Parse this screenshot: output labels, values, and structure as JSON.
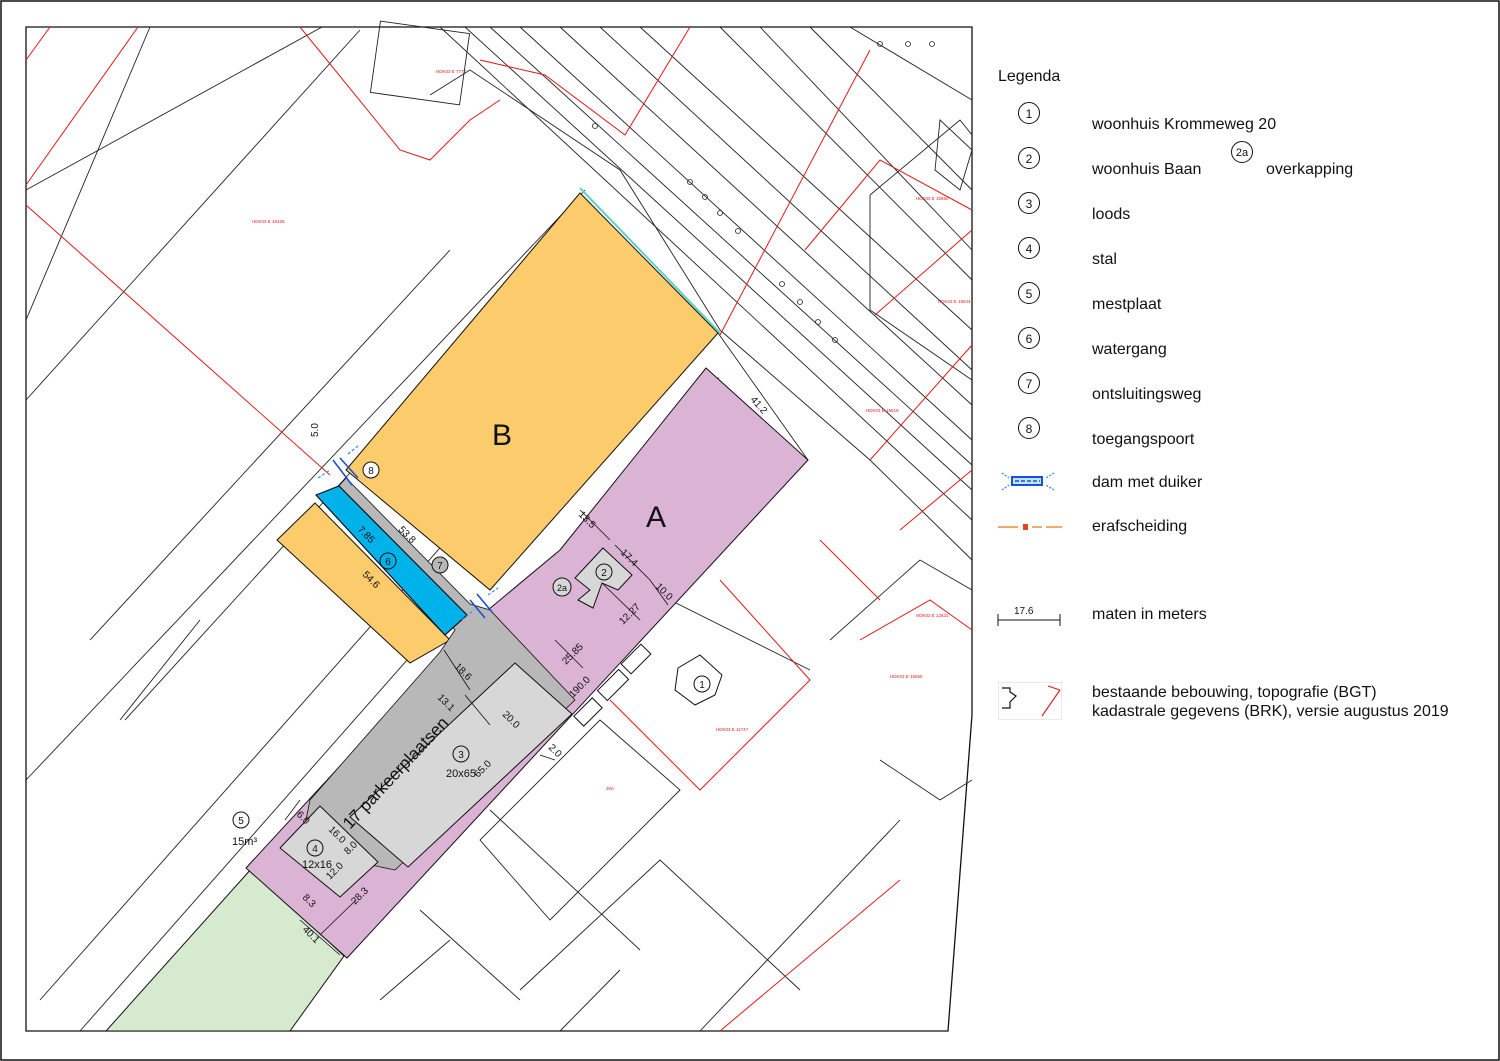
{
  "map": {
    "area_labels": {
      "a": "A",
      "b": "B"
    },
    "markers": {
      "m1": "1",
      "m2": "2",
      "m2a": "2a",
      "m3": "3",
      "m4": "4",
      "m5": "5",
      "m6": "6",
      "m7": "7",
      "m8": "8"
    },
    "texts": {
      "parking": "17 parkeerplaatsen",
      "loods_size": "20x65",
      "stal_size": "12x16",
      "mestplaat_volume": "15m³"
    },
    "dimensions": {
      "d41_2": "41.2",
      "d5_0": "5.0",
      "d53_8": "53.8",
      "d7_85": "7.85",
      "d54_6": "54.6",
      "d13_5": "13.5",
      "d17_4": "17.4",
      "d10_0": "10.0",
      "d12_27": "12.27",
      "d25_85": "25.85",
      "d190_0": "190.0",
      "d18_6": "18.6",
      "d13_1": "13.1",
      "d20_0": "20.0",
      "d65_0": "65.0",
      "d2_0": "2.0",
      "d16_0": "16.0",
      "d8_0": "8.0",
      "d12_0": "12.0",
      "d8_3": "8.3",
      "d28_3": "28.3",
      "d40_1": "40.1",
      "d6_0": "6.0"
    },
    "colors": {
      "area_a": "#dbb3d4",
      "area_b": "#fbcb6c",
      "watergang": "#00b2ea",
      "grass": "#d6ead0",
      "paving": "#b8b8b8",
      "building": "#d7d7d7",
      "cadastre": "#e01a1a",
      "dam": "#1a4fd6"
    }
  },
  "legend": {
    "title": "Legenda",
    "items": [
      {
        "symbol": "1",
        "label": "woonhuis Krommeweg 20"
      },
      {
        "symbol": "2",
        "label": "woonhuis Baan",
        "extra_symbol": "2a",
        "extra_label": "overkapping"
      },
      {
        "symbol": "3",
        "label": "loods"
      },
      {
        "symbol": "4",
        "label": "stal"
      },
      {
        "symbol": "5",
        "label": "mestplaat"
      },
      {
        "symbol": "6",
        "label": "watergang"
      },
      {
        "symbol": "7",
        "label": "ontsluitingsweg"
      },
      {
        "symbol": "8",
        "label": "toegangspoort"
      },
      {
        "symbol_icon": "dam-duiker-icon",
        "label": "dam met duiker"
      },
      {
        "symbol_icon": "erafscheiding-line-icon",
        "label": "erafscheiding"
      },
      {
        "scale_value": "17.6",
        "label": "maten in meters"
      },
      {
        "symbol_icon": "bgt-brk-icon",
        "label": "bestaande bebouwing, topografie (BGT)",
        "label2": "kadastrale gegevens (BRK), versie augustus 2019"
      }
    ]
  }
}
